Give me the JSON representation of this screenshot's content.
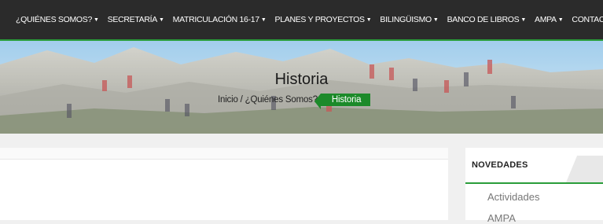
{
  "nav": {
    "items": [
      {
        "label": "¿QUIÉNES SOMOS?",
        "dropdown": true
      },
      {
        "label": "SECRETARÍA",
        "dropdown": true
      },
      {
        "label": "MATRICULACIÓN 16-17",
        "dropdown": true
      },
      {
        "label": "PLANES Y PROYECTOS",
        "dropdown": true
      },
      {
        "label": "BILINGÜISMO",
        "dropdown": true
      },
      {
        "label": "BANCO DE LIBROS",
        "dropdown": true
      },
      {
        "label": "AMPA",
        "dropdown": true
      },
      {
        "label": "CONTACTO",
        "dropdown": false
      }
    ],
    "caret": "▼"
  },
  "hero": {
    "title": "Historia",
    "breadcrumb": {
      "home": "Inicio",
      "separator": "/",
      "parent": "¿Quiénes Somos?",
      "current": "Historia"
    }
  },
  "sidebar": {
    "title": "NOVEDADES",
    "items": [
      "Actividades",
      "AMPA"
    ]
  },
  "colors": {
    "accent": "#2a9d3a",
    "nav_bg": "#2b2b2b",
    "breadcrumb_current_bg": "#1c8a2a"
  }
}
